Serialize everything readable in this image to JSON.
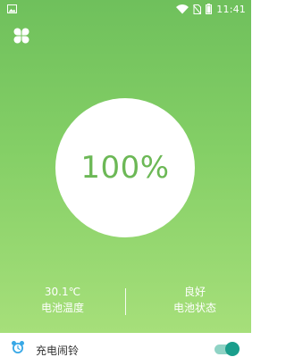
{
  "status_bar": {
    "time": "11:41",
    "icons": [
      "image-icon",
      "wifi-icon",
      "no-sim-icon",
      "battery-icon"
    ]
  },
  "header": {
    "menu_icon": "clover-icon"
  },
  "battery": {
    "percent_text": "100%",
    "level": 1.0
  },
  "stats": {
    "temperature": {
      "value": "30.1℃",
      "label": "电池温度"
    },
    "status": {
      "value": "良好",
      "label": "电池状态"
    }
  },
  "settings": {
    "charge_alarm": {
      "label": "充电闹铃",
      "icon": "alarm-clock-icon",
      "enabled": true
    }
  },
  "colors": {
    "gradient_top": "#6fc05c",
    "gradient_bottom": "#a6df7a",
    "percent_text": "#6cb856",
    "toggle_on": "#1a9e8c",
    "toggle_track": "#8fd3c5",
    "alarm_icon": "#38a8e6"
  }
}
